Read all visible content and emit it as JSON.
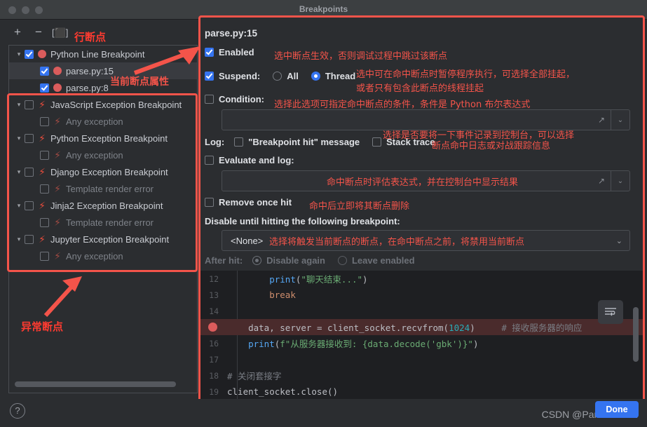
{
  "window": {
    "title": "Breakpoints",
    "traffic_lights": [
      "close-dot",
      "minimize-dot",
      "zoom-dot"
    ]
  },
  "left_panel": {
    "toolbar": {
      "add": "+",
      "remove": "−",
      "snapshot": "[⬛]"
    },
    "annotation_line_breakpoint": "行断点",
    "annotation_current_props": "当前断点属性",
    "annotation_exception_breakpoint": "异常断点",
    "tree": [
      {
        "label": "Python Line Breakpoint",
        "checked": true,
        "icon": "breakpoint-dot-icon",
        "expandable": true,
        "level": 0,
        "selected": false,
        "dim": false
      },
      {
        "label": "parse.py:15",
        "checked": true,
        "icon": "breakpoint-dot-icon",
        "expandable": false,
        "level": 1,
        "selected": true,
        "dim": false
      },
      {
        "label": "parse.py:8",
        "checked": true,
        "icon": "breakpoint-dot-icon",
        "expandable": false,
        "level": 1,
        "selected": false,
        "dim": false
      },
      {
        "label": "JavaScript Exception Breakpoint",
        "checked": false,
        "icon": "bolt-icon",
        "expandable": true,
        "level": 0,
        "selected": false,
        "dim": false
      },
      {
        "label": "Any exception",
        "checked": false,
        "icon": "bolt-icon",
        "expandable": false,
        "level": 1,
        "selected": false,
        "dim": true
      },
      {
        "label": "Python Exception Breakpoint",
        "checked": false,
        "icon": "bolt-icon",
        "expandable": true,
        "level": 0,
        "selected": false,
        "dim": false
      },
      {
        "label": "Any exception",
        "checked": false,
        "icon": "bolt-icon",
        "expandable": false,
        "level": 1,
        "selected": false,
        "dim": true
      },
      {
        "label": "Django Exception Breakpoint",
        "checked": false,
        "icon": "bolt-icon",
        "expandable": true,
        "level": 0,
        "selected": false,
        "dim": false
      },
      {
        "label": "Template render error",
        "checked": false,
        "icon": "bolt-icon",
        "expandable": false,
        "level": 1,
        "selected": false,
        "dim": true
      },
      {
        "label": "Jinja2 Exception Breakpoint",
        "checked": false,
        "icon": "bolt-icon",
        "expandable": true,
        "level": 0,
        "selected": false,
        "dim": false
      },
      {
        "label": "Template render error",
        "checked": false,
        "icon": "bolt-icon",
        "expandable": false,
        "level": 1,
        "selected": false,
        "dim": true
      },
      {
        "label": "Jupyter Exception Breakpoint",
        "checked": false,
        "icon": "bolt-icon",
        "expandable": true,
        "level": 0,
        "selected": false,
        "dim": false
      },
      {
        "label": "Any exception",
        "checked": false,
        "icon": "bolt-icon",
        "expandable": false,
        "level": 1,
        "selected": false,
        "dim": true
      }
    ]
  },
  "details": {
    "breakpoint_title": "parse.py:15",
    "enabled_label": "Enabled",
    "enabled_checked": true,
    "suspend_label": "Suspend:",
    "suspend_checked": true,
    "suspend_all_label": "All",
    "suspend_thread_label": "Thread",
    "suspend_selected": "Thread",
    "condition_label": "Condition:",
    "condition_checked": false,
    "condition_value": "",
    "log_label": "Log:",
    "log_message_label": "\"Breakpoint hit\" message",
    "log_message_checked": false,
    "stack_trace_label": "Stack trace",
    "stack_trace_checked": false,
    "evaluate_label": "Evaluate and log:",
    "evaluate_checked": false,
    "evaluate_value": "",
    "remove_once_hit_label": "Remove once hit",
    "remove_once_hit_checked": false,
    "disable_until_label": "Disable until hitting the following breakpoint:",
    "dependency_value": "<None>",
    "after_hit_label": "After hit:",
    "after_hit_disable_again": "Disable again",
    "after_hit_leave_enabled": "Leave enabled",
    "after_hit_selected": "Disable again",
    "expand_icon": "↗",
    "chevron_icon": "⌄"
  },
  "annotations": {
    "enabled": "选中断点生效，否则调试过程中跳过该断点",
    "suspend_1": "选中可在命中断点时暂停程序执行，可选择全部挂起，",
    "suspend_2": "或者只有包含此断点的线程挂起",
    "condition": "选择此选项可指定命中断点的条件，条件是 Python 布尔表达式",
    "log_1": "选择是否要将一下事件记录到控制台，可以选择",
    "log_2": "断点命中日志或对战跟踪信息",
    "evaluate": "命中断点时评估表达式，并在控制台中显示结果",
    "remove_once_hit": "命中后立即将其断点删除",
    "dependency": "选择将触发当前断点的断点，在命中断点之前，将禁用当前断点"
  },
  "editor": {
    "wrap_icon": "soft-wrap-icon",
    "lines": [
      {
        "num": "12",
        "breakpoint": false,
        "highlight": false
      },
      {
        "num": "13",
        "breakpoint": false,
        "highlight": false
      },
      {
        "num": "14",
        "breakpoint": false,
        "highlight": false
      },
      {
        "num": "15",
        "breakpoint": true,
        "highlight": true
      },
      {
        "num": "16",
        "breakpoint": false,
        "highlight": false
      },
      {
        "num": "17",
        "breakpoint": false,
        "highlight": false
      },
      {
        "num": "18",
        "breakpoint": false,
        "highlight": false
      },
      {
        "num": "19",
        "breakpoint": false,
        "highlight": false
      }
    ],
    "code": {
      "l12_call": "print",
      "l12_str": "\"聊天结束...\"",
      "l13_kw": "break",
      "l15_lhs": "data, server = client_socket.recvfrom(",
      "l15_num": "1024",
      "l15_close": ")",
      "l15_comment": "# 接收服务器的响应",
      "l16_call": "print",
      "l16_fstr": "f\"从服务器接收到: {data.decode(",
      "l16_gbk": "'gbk'",
      "l16_tail": ")}\"",
      "l18_comment": "# 关闭套接字",
      "l19_code": "client_socket.close()"
    }
  },
  "footer": {
    "help_icon": "?",
    "watermark": "CSDN @Pandaconda",
    "done_label": "Done"
  },
  "colors": {
    "accent_blue": "#3574f0",
    "annotation_red": "#f4544a",
    "breakpoint_red": "#db5c5c",
    "panel_bg": "#2b2d30",
    "editor_bg": "#1e1f22"
  }
}
